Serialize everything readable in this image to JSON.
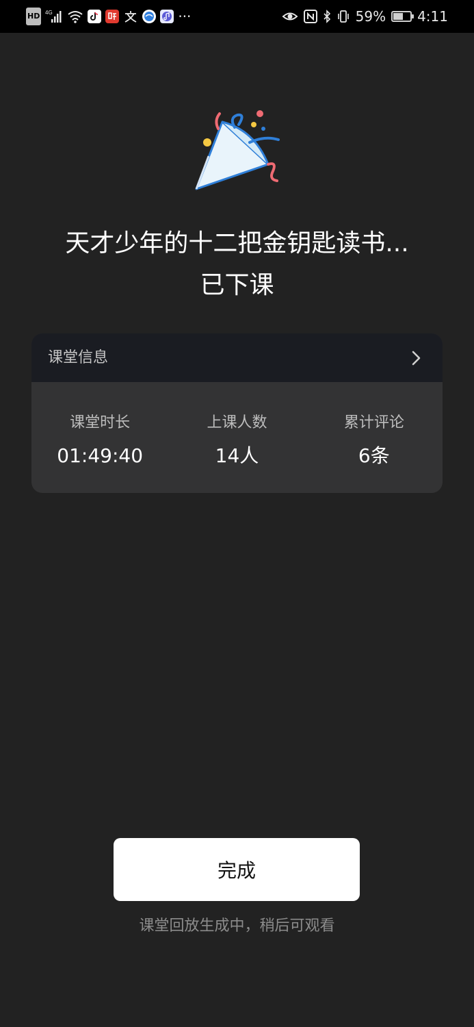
{
  "status_bar": {
    "hd_label": "HD",
    "network_label": "4G",
    "more_label": "···",
    "battery_percent_text": "59%",
    "battery_level": 0.59,
    "time": "4:11",
    "icons": [
      "signal-icon",
      "wifi-icon",
      "tiktok-app-icon",
      "ting-app-icon",
      "wen-app-icon",
      "browser-app-icon",
      "music-app-icon",
      "eye-icon",
      "nfc-icon",
      "bluetooth-icon",
      "vibrate-icon",
      "battery-icon"
    ]
  },
  "celebration": {
    "icon": "party-popper-icon",
    "title_line1": "天才少年的十二把金钥匙读书...",
    "title_line2": "已下课"
  },
  "class_info": {
    "header_title": "课堂信息",
    "stats": [
      {
        "label": "课堂时长",
        "value": "01:49:40"
      },
      {
        "label": "上课人数",
        "value": "14人"
      },
      {
        "label": "累计评论",
        "value": "6条"
      }
    ]
  },
  "actions": {
    "done_label": "完成",
    "playback_note": "课堂回放生成中，稍后可观看"
  },
  "colors": {
    "background": "#222222",
    "card": "#333334",
    "card_header": "#1a1c22",
    "button": "#ffffff",
    "accent_blue": "#3b82d6",
    "accent_red": "#ef6b73",
    "accent_yellow": "#f5c842"
  }
}
